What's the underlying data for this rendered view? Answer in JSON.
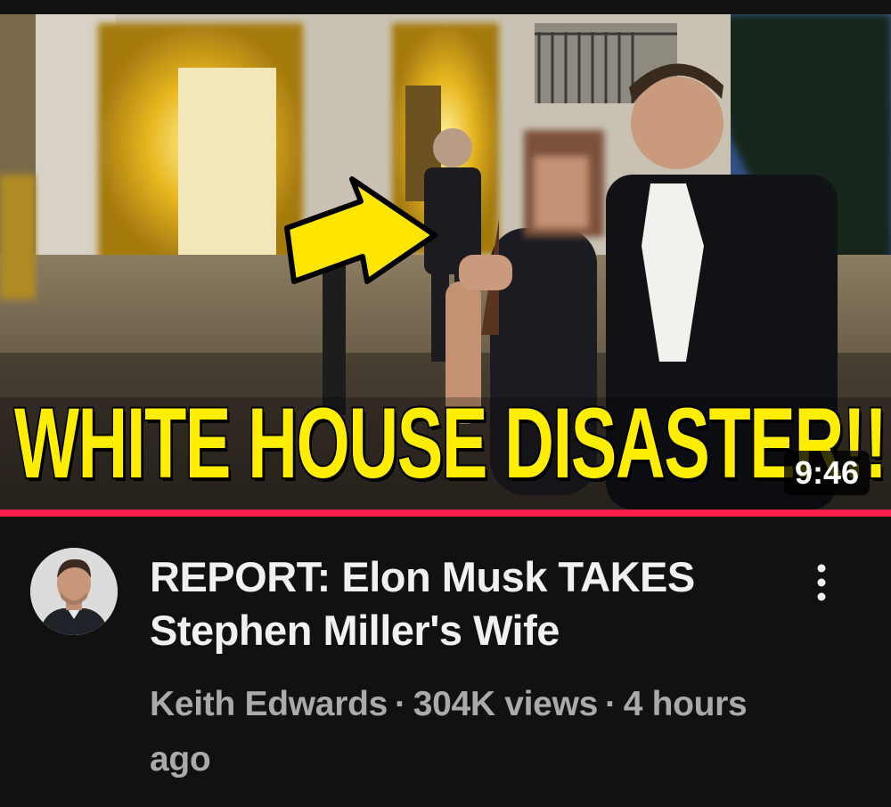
{
  "video": {
    "thumbnail_headline": "WHITE HOUSE DISASTER!!!",
    "duration": "9:46",
    "watch_progress_fraction": 1.0,
    "title": "REPORT: Elon Musk TAKES Stephen Miller's Wife",
    "channel": "Keith Edwards",
    "separator": "·",
    "views": "304K views",
    "age": "4 hours ago"
  },
  "icons": {
    "more": "more-vertical-icon",
    "avatar": "channel-avatar",
    "arrow": "arrow-annotation"
  },
  "colors": {
    "background": "#0f0f0f",
    "headline_yellow": "#ffee00",
    "progress_red": "#ff1f4a",
    "title_text": "#f1f1f1",
    "meta_text": "#aaaaaa"
  }
}
